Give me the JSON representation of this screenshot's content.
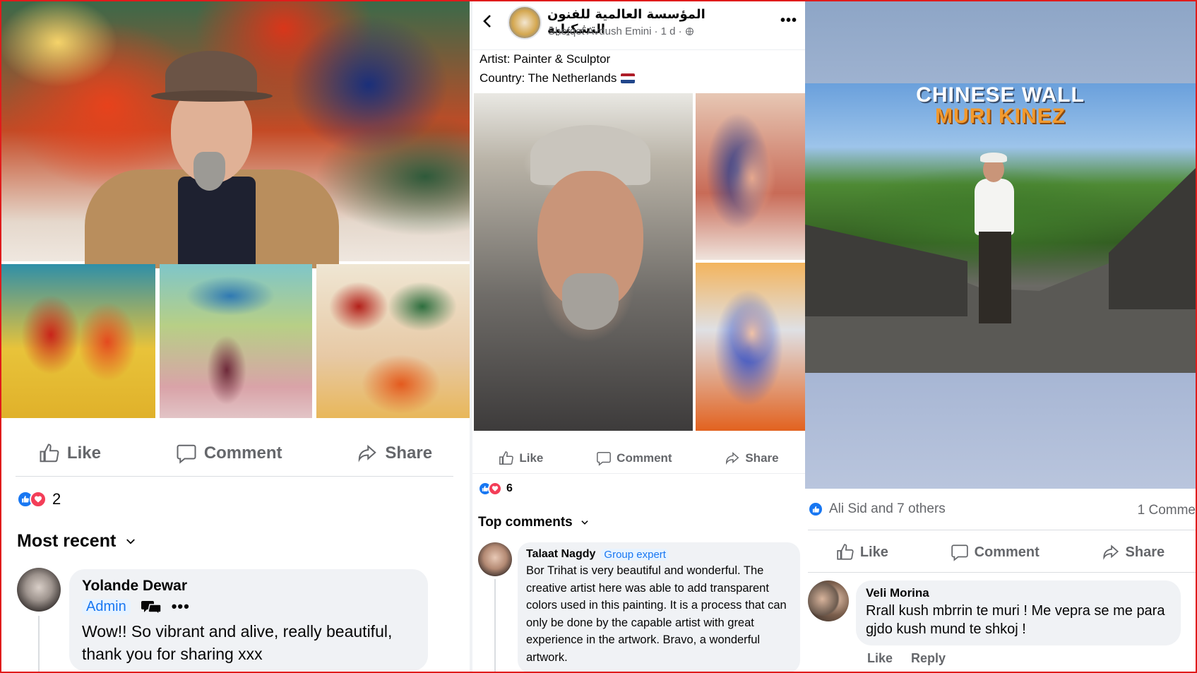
{
  "colors": {
    "facebook_blue": "#1877f2",
    "love_red": "#f33e58",
    "secondary_text": "#65676b",
    "bubble_bg": "#f0f2f5",
    "frame_red": "#e01b1b",
    "chinese_wall_white": "#ffffff",
    "muri_kinez_orange": "#f29a2e"
  },
  "icons": {
    "like": "thumbs-up-icon",
    "comment": "comment-icon",
    "share": "share-icon",
    "back": "chevron-left-icon",
    "more": "more-icon",
    "expand": "chevron-down-icon",
    "globe": "globe-icon",
    "flag": "netherlands-flag-icon",
    "admin_extra": "community-chat-icon"
  },
  "panel1": {
    "actions": {
      "like": "Like",
      "comment": "Comment",
      "share": "Share"
    },
    "reaction_count": "2",
    "sort_label": "Most recent",
    "comment": {
      "author": "Yolande Dewar",
      "badge": "Admin",
      "text": "Wow!! So vibrant and alive, really beautiful, thank you for sharing xxx"
    }
  },
  "panel2": {
    "group_name": "المؤسسة العالمية للفنون التشكيلية",
    "author": "Shefqet Avdush Emini",
    "meta": "· 1 d ·",
    "post_line1": "Artist: Painter & Sculptor",
    "post_line2": "Country: The Netherlands",
    "actions": {
      "like": "Like",
      "comment": "Comment",
      "share": "Share"
    },
    "reaction_count": "6",
    "sort_label": "Top comments",
    "comment": {
      "author": "Talaat Nagdy",
      "badge": "Group expert",
      "text": "Bor Trihat is very beautiful and wonderful. The creative artist here was able to add transparent colors used in this painting. It is a process that can only be done by the capable artist with great experience in the artwork. Bravo, a wonderful artwork."
    }
  },
  "panel3": {
    "banner_line1": "CHINESE WALL",
    "banner_line2": "MURI KINEZ",
    "reactions_text": "Ali Sid and 7 others",
    "comments_count": "1 Comme",
    "actions": {
      "like": "Like",
      "comment": "Comment",
      "share": "Share"
    },
    "comment": {
      "author": "Veli Morina",
      "text": "Rrall kush mbrrin te muri ! Me vepra se me para gjdo kush mund te shkoj !",
      "like": "Like",
      "reply": "Reply"
    }
  }
}
